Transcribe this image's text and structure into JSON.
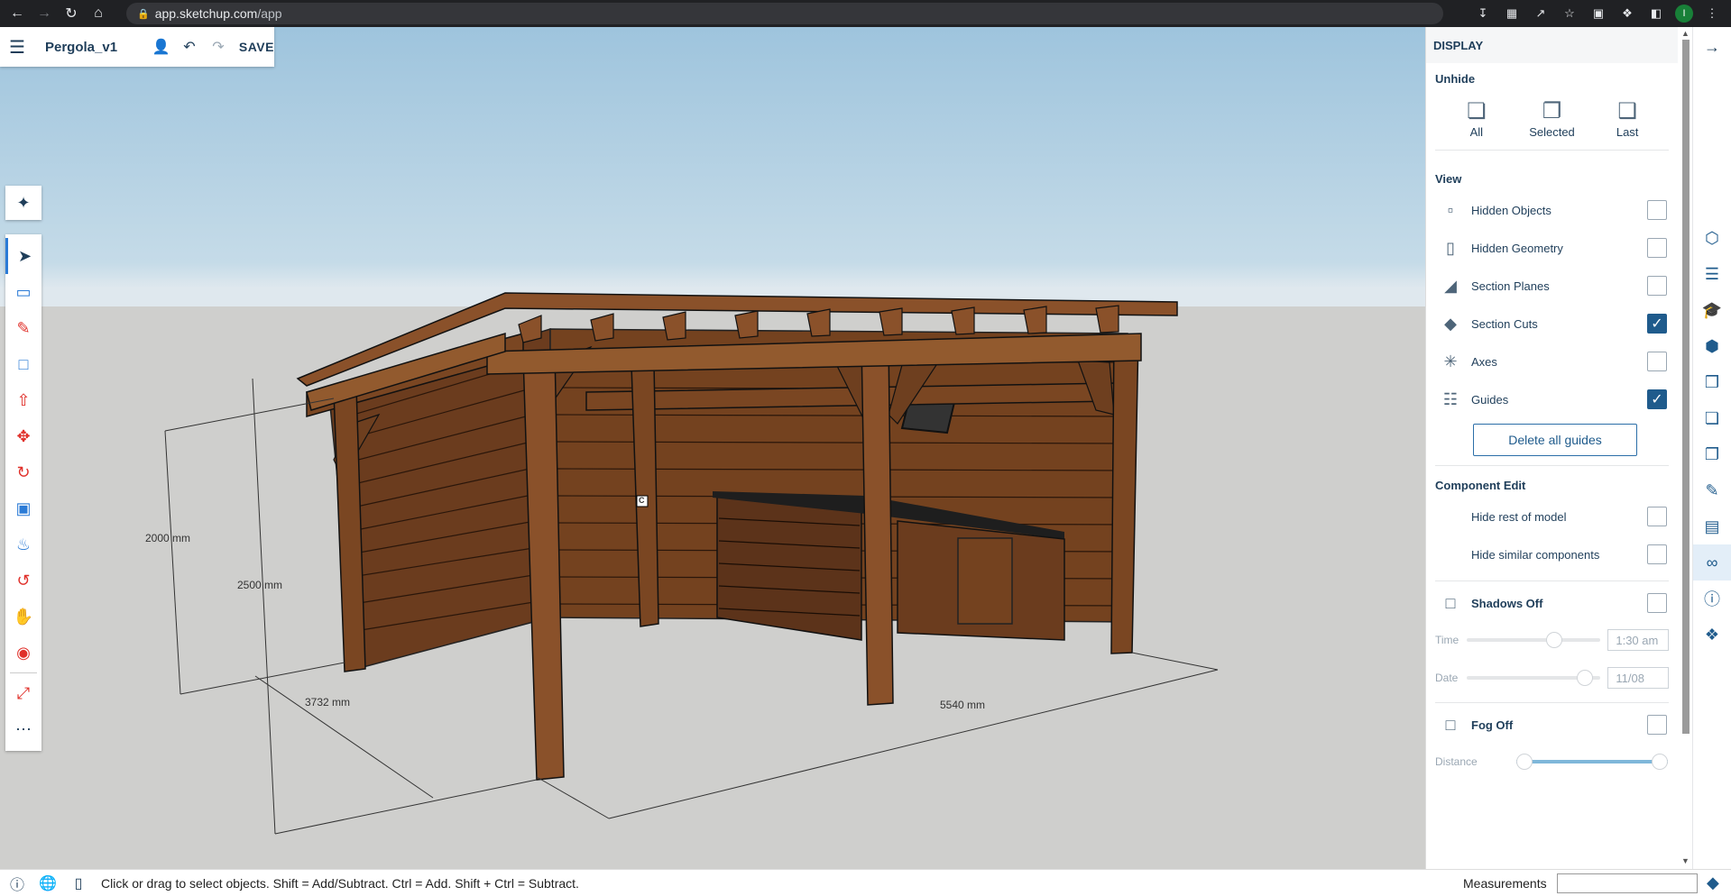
{
  "browser": {
    "url_host": "app.sketchup.com",
    "url_path": "/app",
    "profile_initial": "I"
  },
  "toolbar": {
    "title": "Pergola_v1",
    "save_label": "SAVE"
  },
  "dimensions": {
    "d1": "2000 mm",
    "d2": "2500 mm",
    "d3": "3732 mm",
    "d4": "5540 mm",
    "marker": "C"
  },
  "panel": {
    "header": "DISPLAY",
    "unhide": {
      "title": "Unhide",
      "items": [
        {
          "label": "All",
          "icon": "unhide-all-icon"
        },
        {
          "label": "Selected",
          "icon": "unhide-selected-icon"
        },
        {
          "label": "Last",
          "icon": "unhide-last-icon"
        }
      ]
    },
    "view": {
      "title": "View",
      "items": [
        {
          "label": "Hidden Objects",
          "checked": false,
          "icon": "hidden-objects-icon"
        },
        {
          "label": "Hidden Geometry",
          "checked": false,
          "icon": "hidden-geometry-icon"
        },
        {
          "label": "Section Planes",
          "checked": false,
          "icon": "section-planes-icon"
        },
        {
          "label": "Section Cuts",
          "checked": true,
          "icon": "section-cuts-icon"
        },
        {
          "label": "Axes",
          "checked": false,
          "icon": "axes-icon"
        },
        {
          "label": "Guides",
          "checked": true,
          "icon": "guides-icon"
        }
      ],
      "delete_guides": "Delete all guides"
    },
    "component_edit": {
      "title": "Component Edit",
      "items": [
        {
          "label": "Hide rest of model",
          "checked": false
        },
        {
          "label": "Hide similar components",
          "checked": false
        }
      ]
    },
    "shadows": {
      "label": "Shadows Off",
      "time_label": "Time",
      "time_value": "1:30 am",
      "time_fraction": 0.58,
      "date_label": "Date",
      "date_value": "11/08",
      "date_fraction": 0.8
    },
    "fog": {
      "label": "Fog Off",
      "distance_label": "Distance",
      "range_start": 0.0,
      "range_end": 1.0
    }
  },
  "status": {
    "hint": "Click or drag to select objects. Shift = Add/Subtract. Ctrl = Add. Shift + Ctrl = Subtract.",
    "measurements_label": "Measurements"
  }
}
